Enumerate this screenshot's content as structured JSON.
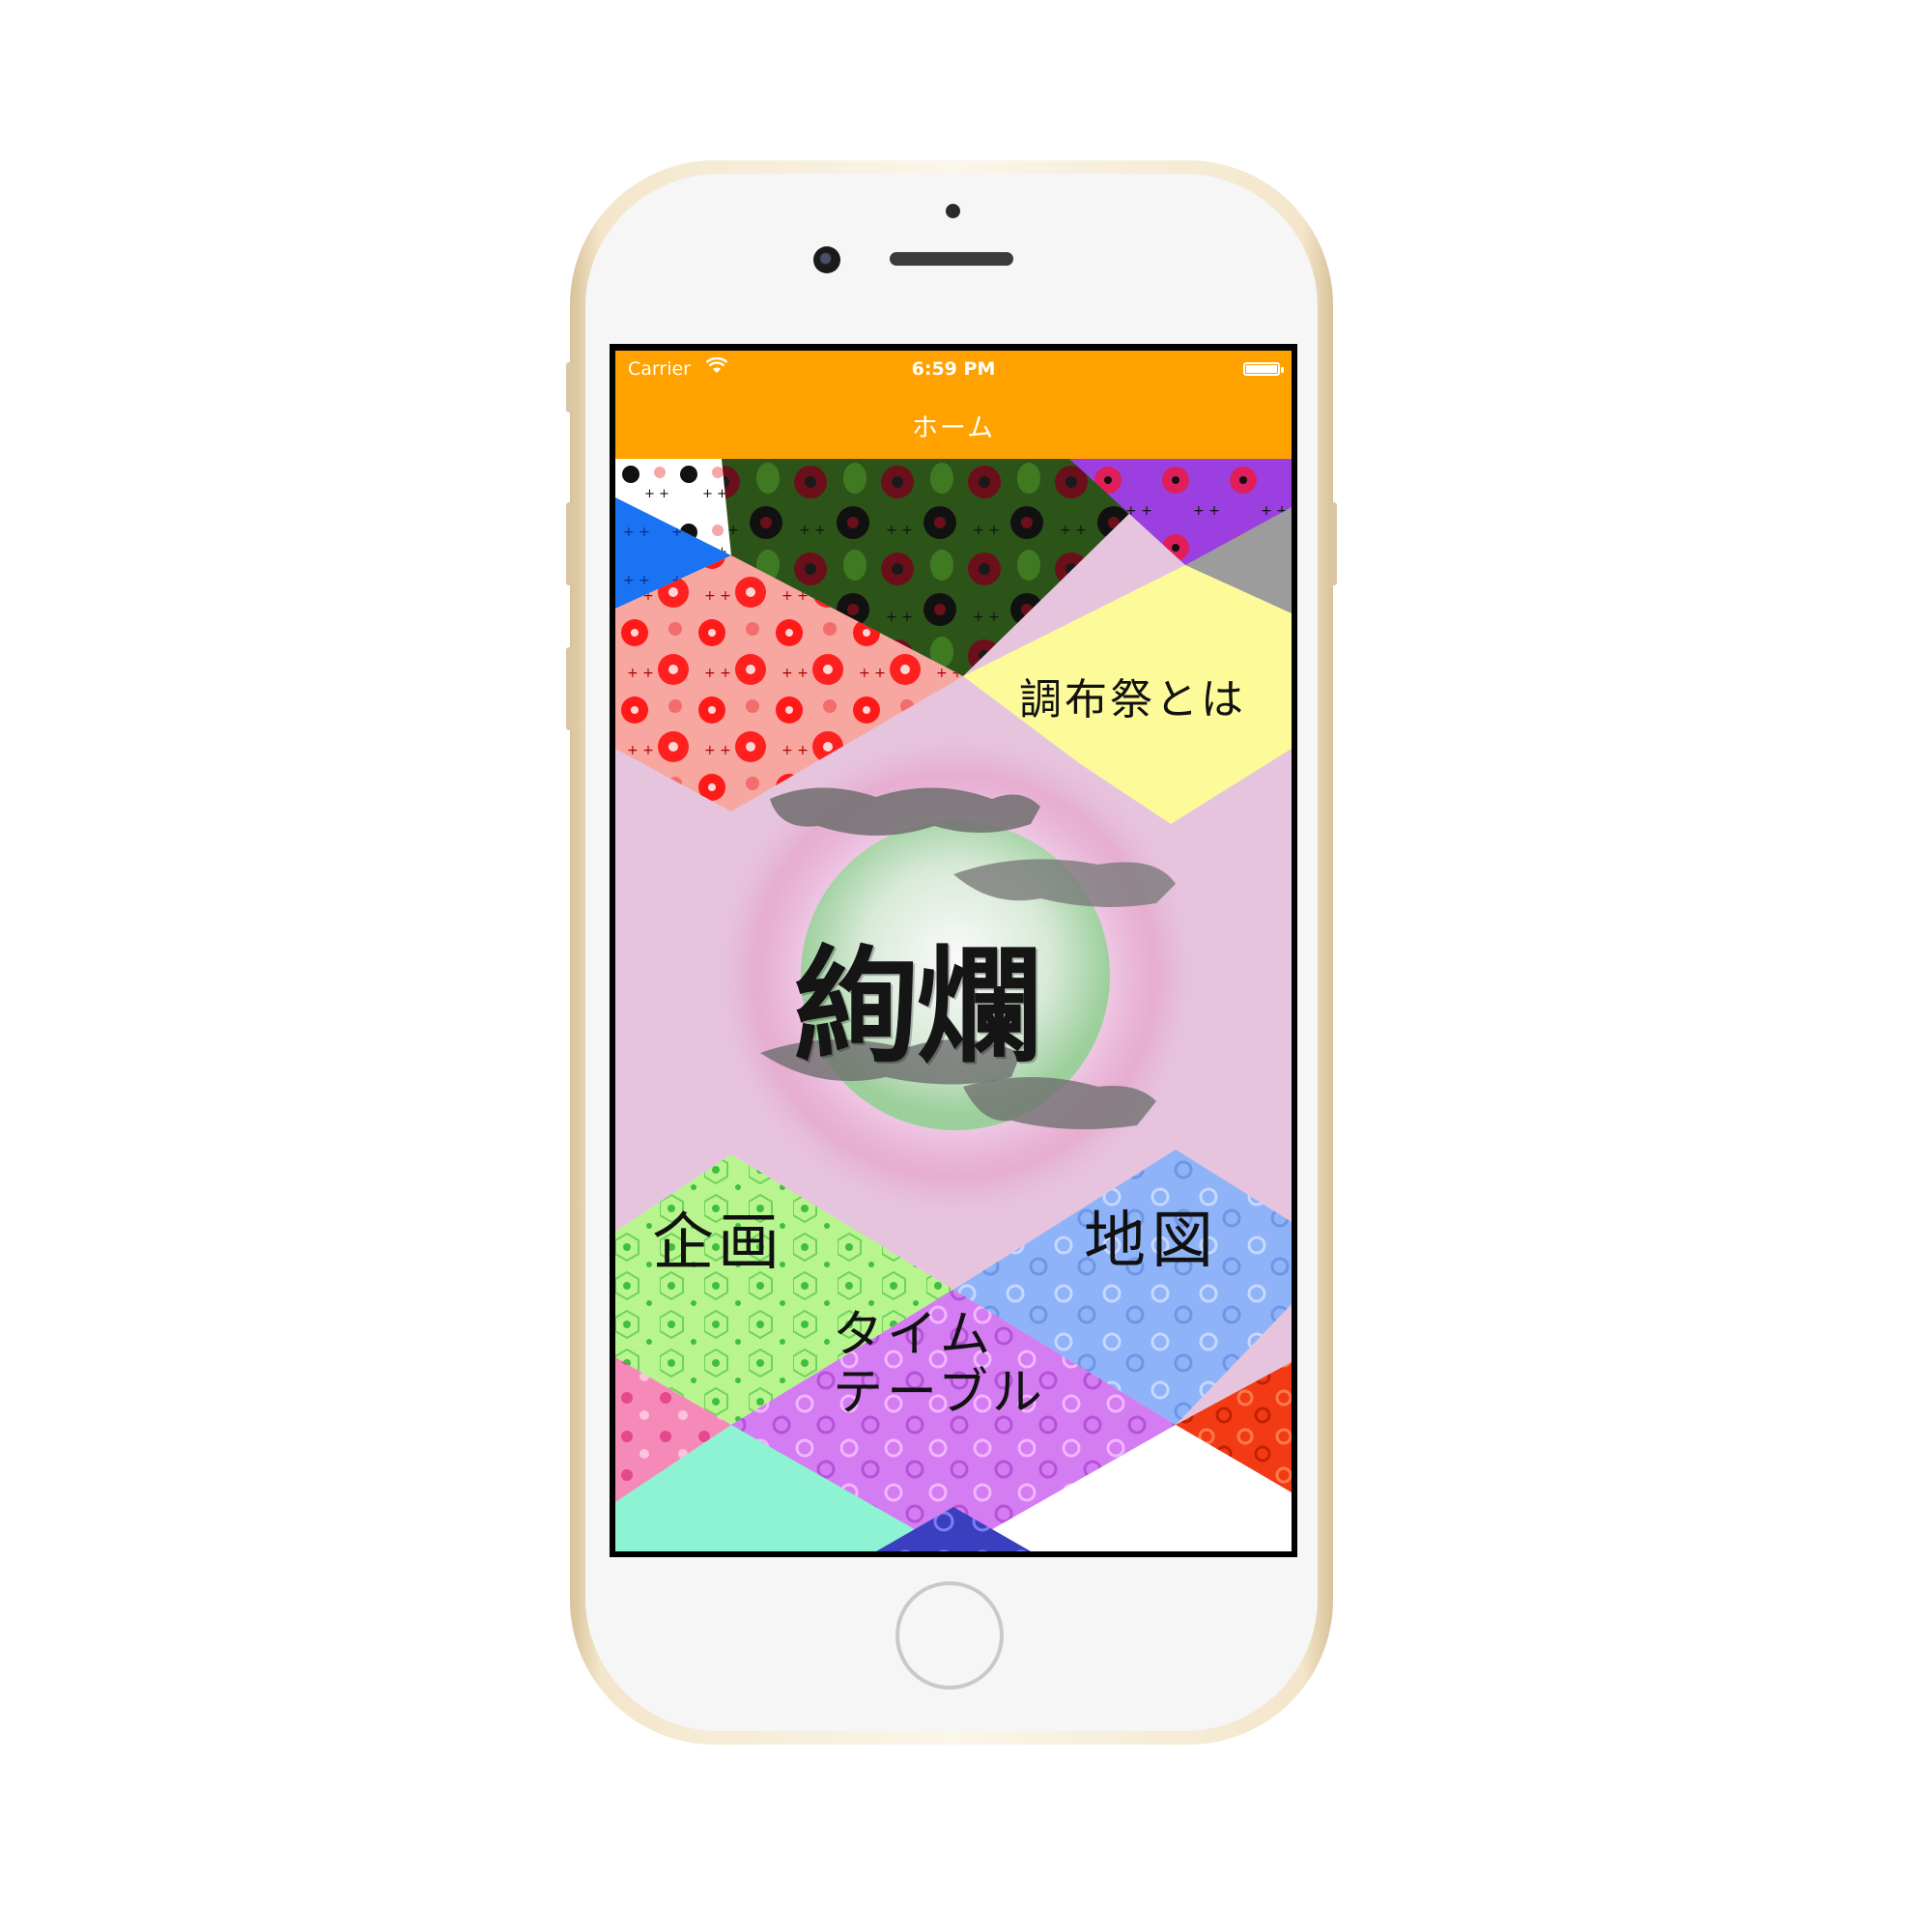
{
  "status_bar": {
    "carrier": "Carrier",
    "time": "6:59 PM"
  },
  "nav_bar": {
    "title": "ホーム"
  },
  "menu": {
    "about": "調布祭とは",
    "events": "企画",
    "map": "地図",
    "timetable_line1": "タイム",
    "timetable_line2": "テーブル"
  },
  "logo": {
    "text": "絢爛"
  },
  "colors": {
    "nav_bar": "#ffa200",
    "background": "#e6c4de",
    "about_tile": "#fdfb99",
    "events_tile": "#b9f58e",
    "map_tile": "#8fb3f9",
    "timetable_tile": "#d47cf2",
    "red_floral": "#f36d6d",
    "dark_green_floral": "#2d5418",
    "aqua": "#8ef3d2",
    "orange_red": "#f23b15",
    "phone_gold": "#e9d9b8"
  }
}
